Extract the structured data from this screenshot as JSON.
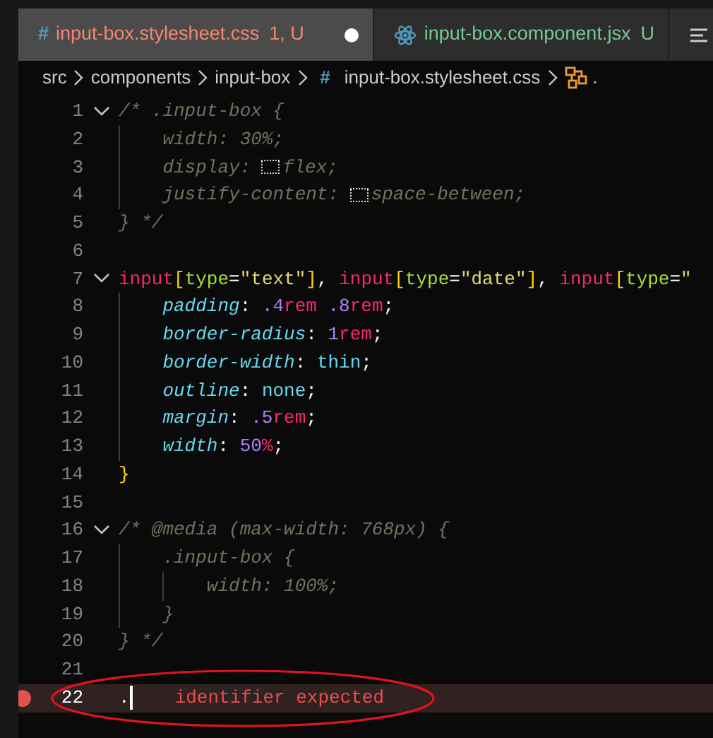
{
  "tabs": [
    {
      "kind": "css",
      "icon": "#",
      "label": "input-box.stylesheet.css",
      "decoration": "1, U",
      "color": "#f48771",
      "selected": true,
      "modified": true
    },
    {
      "kind": "react",
      "label": "input-box.component.jsx",
      "decoration": "U",
      "color": "#73c991",
      "selected": false
    },
    {
      "kind": "outline",
      "selected": false
    }
  ],
  "breadcrumbs": [
    {
      "label": "src"
    },
    {
      "label": "components"
    },
    {
      "label": "input-box"
    },
    {
      "kind": "css",
      "icon": "#",
      "label": "input-box.stylesheet.css"
    },
    {
      "kind": "symbol",
      "label": "."
    }
  ],
  "editor": {
    "lines": [
      {
        "number": "1",
        "fold": true,
        "tokens": [
          {
            "kind": "comment",
            "text": "/* .input-box {"
          }
        ]
      },
      {
        "number": "2",
        "tokens": [
          {
            "kind": "comment",
            "text": "    width: 30%;"
          }
        ]
      },
      {
        "number": "3",
        "tokens": [
          {
            "kind": "comment",
            "text": "    display: "
          },
          {
            "kind": "swatch"
          },
          {
            "kind": "comment",
            "text": "flex;"
          }
        ]
      },
      {
        "number": "4",
        "tokens": [
          {
            "kind": "comment",
            "text": "    justify-content: "
          },
          {
            "kind": "swatch"
          },
          {
            "kind": "comment",
            "text": "space-between;"
          }
        ]
      },
      {
        "number": "5",
        "tokens": [
          {
            "kind": "comment",
            "text": "} */"
          }
        ]
      },
      {
        "number": "6"
      },
      {
        "number": "7",
        "fold": true,
        "tokens": [
          {
            "kind": "selector",
            "text": "input"
          },
          {
            "kind": "bracket",
            "text": "["
          },
          {
            "kind": "attr",
            "text": "type"
          },
          {
            "kind": "punct",
            "text": "="
          },
          {
            "kind": "string",
            "text": "\"text\""
          },
          {
            "kind": "bracket",
            "text": "]"
          },
          {
            "kind": "punct",
            "text": ","
          },
          {
            "kind": "selector",
            "text": " input"
          },
          {
            "kind": "bracket",
            "text": "["
          },
          {
            "kind": "attr",
            "text": "type"
          },
          {
            "kind": "punct",
            "text": "="
          },
          {
            "kind": "string",
            "text": "\"date\""
          },
          {
            "kind": "bracket",
            "text": "]"
          },
          {
            "kind": "punct",
            "text": ","
          },
          {
            "kind": "selector",
            "text": " input"
          },
          {
            "kind": "bracket",
            "text": "["
          },
          {
            "kind": "attr",
            "text": "type"
          },
          {
            "kind": "punct",
            "text": "="
          },
          {
            "kind": "string",
            "text": "\""
          }
        ]
      },
      {
        "number": "8",
        "tokens": [
          {
            "kind": "property",
            "text": "    padding"
          },
          {
            "kind": "punct",
            "text": ":"
          },
          {
            "kind": "number",
            "text": " .4"
          },
          {
            "kind": "unit",
            "text": "rem"
          },
          {
            "kind": "number",
            "text": " .8"
          },
          {
            "kind": "unit",
            "text": "rem"
          },
          {
            "kind": "punct",
            "text": ";"
          }
        ]
      },
      {
        "number": "9",
        "tokens": [
          {
            "kind": "property",
            "text": "    border-radius"
          },
          {
            "kind": "punct",
            "text": ":"
          },
          {
            "kind": "number",
            "text": " 1"
          },
          {
            "kind": "unit",
            "text": "rem"
          },
          {
            "kind": "punct",
            "text": ";"
          }
        ]
      },
      {
        "number": "10",
        "tokens": [
          {
            "kind": "property",
            "text": "    border-width"
          },
          {
            "kind": "punct",
            "text": ":"
          },
          {
            "kind": "value",
            "text": " thin"
          },
          {
            "kind": "punct",
            "text": ";"
          }
        ]
      },
      {
        "number": "11",
        "tokens": [
          {
            "kind": "property",
            "text": "    outline"
          },
          {
            "kind": "punct",
            "text": ":"
          },
          {
            "kind": "value",
            "text": " none"
          },
          {
            "kind": "punct",
            "text": ";"
          }
        ]
      },
      {
        "number": "12",
        "tokens": [
          {
            "kind": "property",
            "text": "    margin"
          },
          {
            "kind": "punct",
            "text": ":"
          },
          {
            "kind": "number",
            "text": " .5"
          },
          {
            "kind": "unit",
            "text": "rem"
          },
          {
            "kind": "punct",
            "text": ";"
          }
        ]
      },
      {
        "number": "13",
        "tokens": [
          {
            "kind": "property",
            "text": "    width"
          },
          {
            "kind": "punct",
            "text": ":"
          },
          {
            "kind": "number",
            "text": " 50"
          },
          {
            "kind": "unit",
            "text": "%"
          },
          {
            "kind": "punct",
            "text": ";"
          }
        ]
      },
      {
        "number": "14",
        "tokens": [
          {
            "kind": "bracket",
            "text": "}"
          }
        ]
      },
      {
        "number": "15"
      },
      {
        "number": "16",
        "fold": true,
        "tokens": [
          {
            "kind": "comment",
            "text": "/* @media (max-width: 768px) {"
          }
        ]
      },
      {
        "number": "17",
        "tokens": [
          {
            "kind": "comment",
            "text": "    .input-box {"
          }
        ]
      },
      {
        "number": "18",
        "tokens": [
          {
            "kind": "comment",
            "text": "        width: 100%;"
          }
        ]
      },
      {
        "number": "19",
        "tokens": [
          {
            "kind": "comment",
            "text": "    }"
          }
        ]
      },
      {
        "number": "20",
        "tokens": [
          {
            "kind": "comment",
            "text": "} */"
          }
        ]
      },
      {
        "number": "21"
      },
      {
        "number": "22",
        "current": true,
        "error": true,
        "tokens": [
          {
            "kind": "punct",
            "text": "."
          }
        ],
        "message": "identifier expected"
      }
    ]
  },
  "annotation": {
    "kind": "ellipse",
    "color": "#e0141e"
  }
}
